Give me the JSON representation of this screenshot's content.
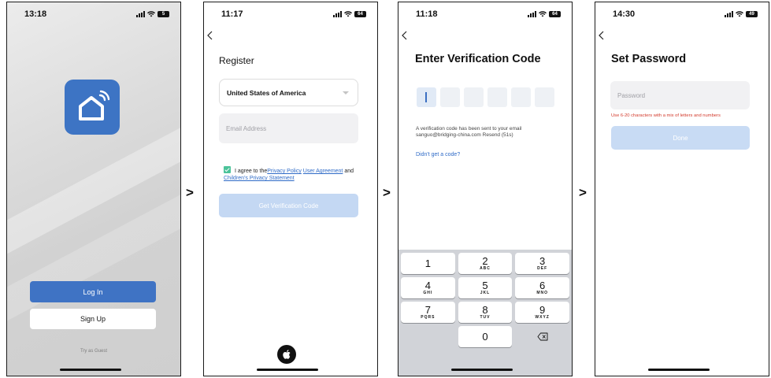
{
  "screens": [
    {
      "time": "13:18",
      "battery": "5",
      "login_label": "Log In",
      "signup_label": "Sign Up",
      "guest_label": "Try as Guest"
    },
    {
      "time": "11:17",
      "battery": "64",
      "title": "Register",
      "country": "United States of America",
      "email_placeholder": "Email Address",
      "agree_prefix": "I agree to the",
      "privacy_policy": "Privacy Policy",
      "user_agreement": "User Agreement",
      "and_text": " and ",
      "children_privacy": "Children's Privacy Statement",
      "verify_label": "Get Verification Code"
    },
    {
      "time": "11:18",
      "battery": "64",
      "title": "Enter Verification Code",
      "info_line1": "A verification code has been sent to your email",
      "info_line2": "sanguo@bridging-china.com  Resend (51s)",
      "didnt_get": "Didn't get a code?",
      "keys": [
        {
          "digit": "1",
          "letters": ""
        },
        {
          "digit": "2",
          "letters": "ABC"
        },
        {
          "digit": "3",
          "letters": "DEF"
        },
        {
          "digit": "4",
          "letters": "GHI"
        },
        {
          "digit": "5",
          "letters": "JKL"
        },
        {
          "digit": "6",
          "letters": "MNO"
        },
        {
          "digit": "7",
          "letters": "PQRS"
        },
        {
          "digit": "8",
          "letters": "TUV"
        },
        {
          "digit": "9",
          "letters": "WXYZ"
        },
        {
          "digit": "0",
          "letters": ""
        }
      ]
    },
    {
      "time": "14:30",
      "battery": "49",
      "title": "Set Password",
      "password_placeholder": "Password",
      "hint": "Use 6-20 characters with a mix of letters and numbers",
      "done_label": "Done"
    }
  ],
  "arrow_glyph": ">",
  "colors": {
    "primary": "#3f73c4",
    "disabled": "#c4d8f3",
    "link": "#2f6bc7",
    "check": "#4cc39a",
    "error": "#d33a2c"
  },
  "icons": [
    "smart-home-icon",
    "back-chevron-icon",
    "apple-icon",
    "delete-key-icon",
    "wifi-icon",
    "signal-icon",
    "battery-icon"
  ]
}
